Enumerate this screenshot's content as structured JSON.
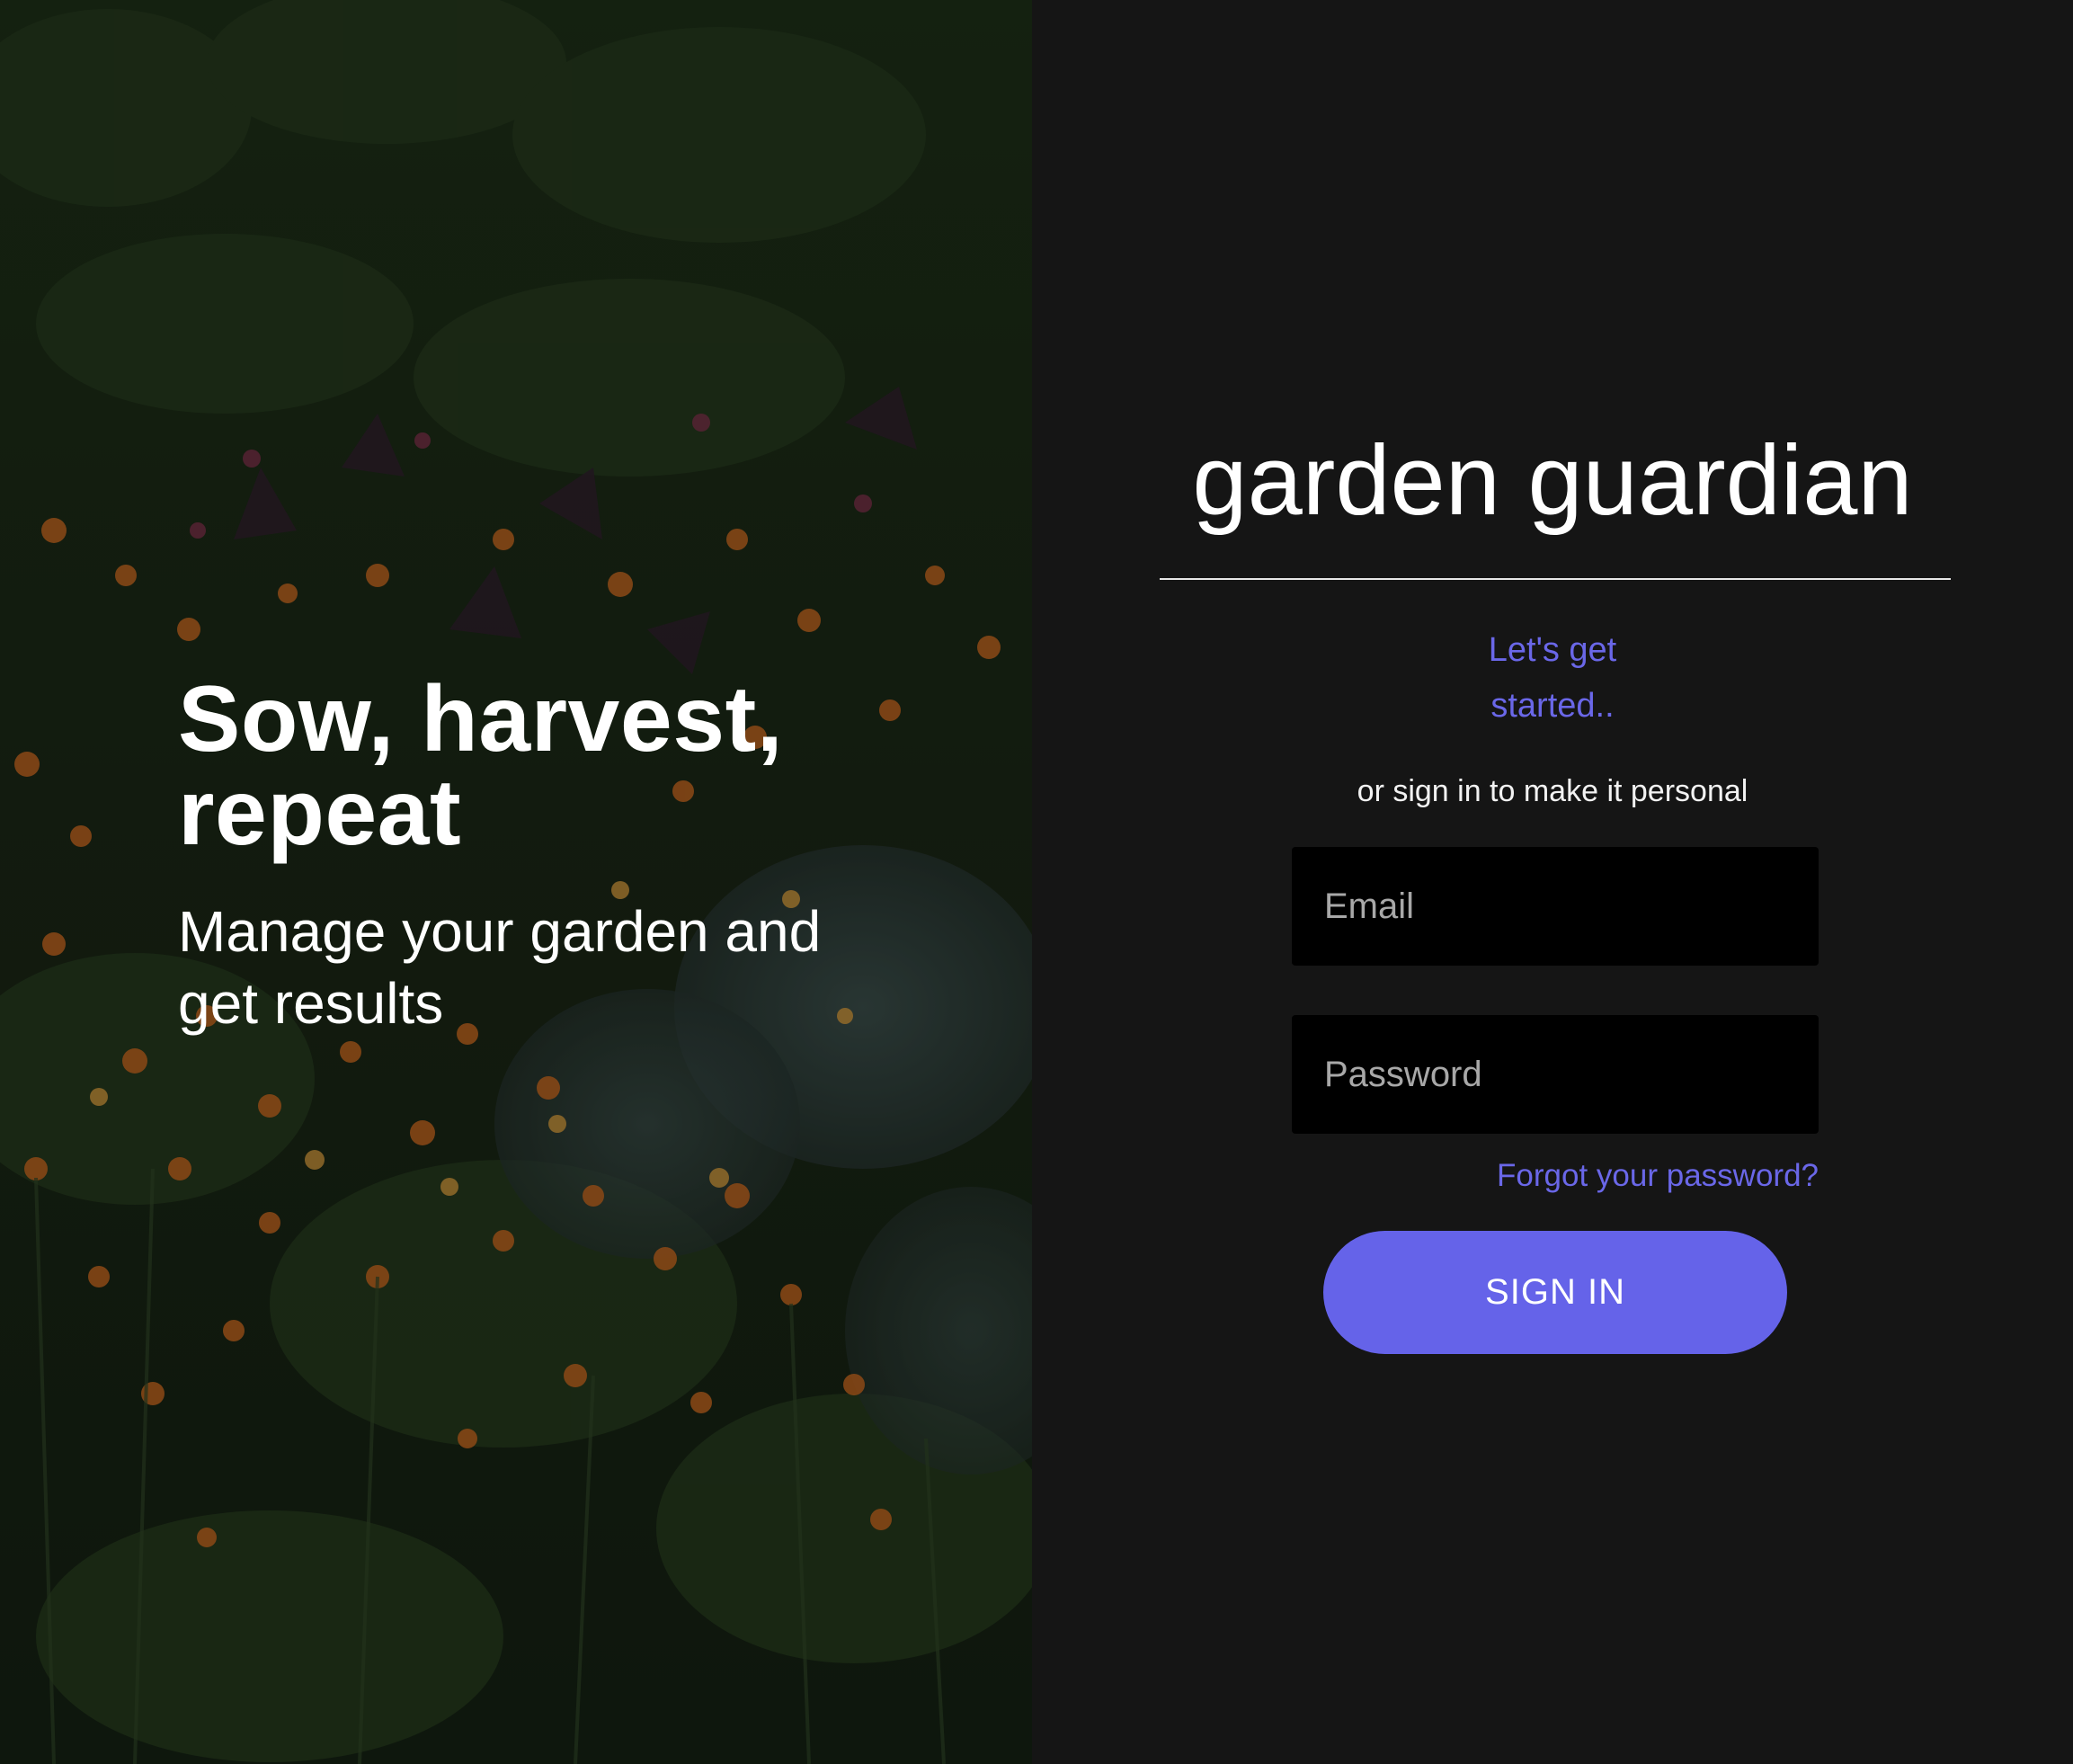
{
  "hero": {
    "title": "Sow, harvest, repeat",
    "subtitle": "Manage your garden and get results"
  },
  "login": {
    "brand": "garden guardian",
    "tagline_line1": "Let's get",
    "tagline_line2": "started..",
    "subtitle": "or sign in to make it personal",
    "email_placeholder": "Email",
    "password_placeholder": "Password",
    "forgot_label": "Forgot your password?",
    "signin_label": "SIGN IN"
  },
  "colors": {
    "accent": "#6563e9",
    "link": "#6a67e8",
    "panel_bg": "#151515",
    "field_bg": "#000000"
  }
}
